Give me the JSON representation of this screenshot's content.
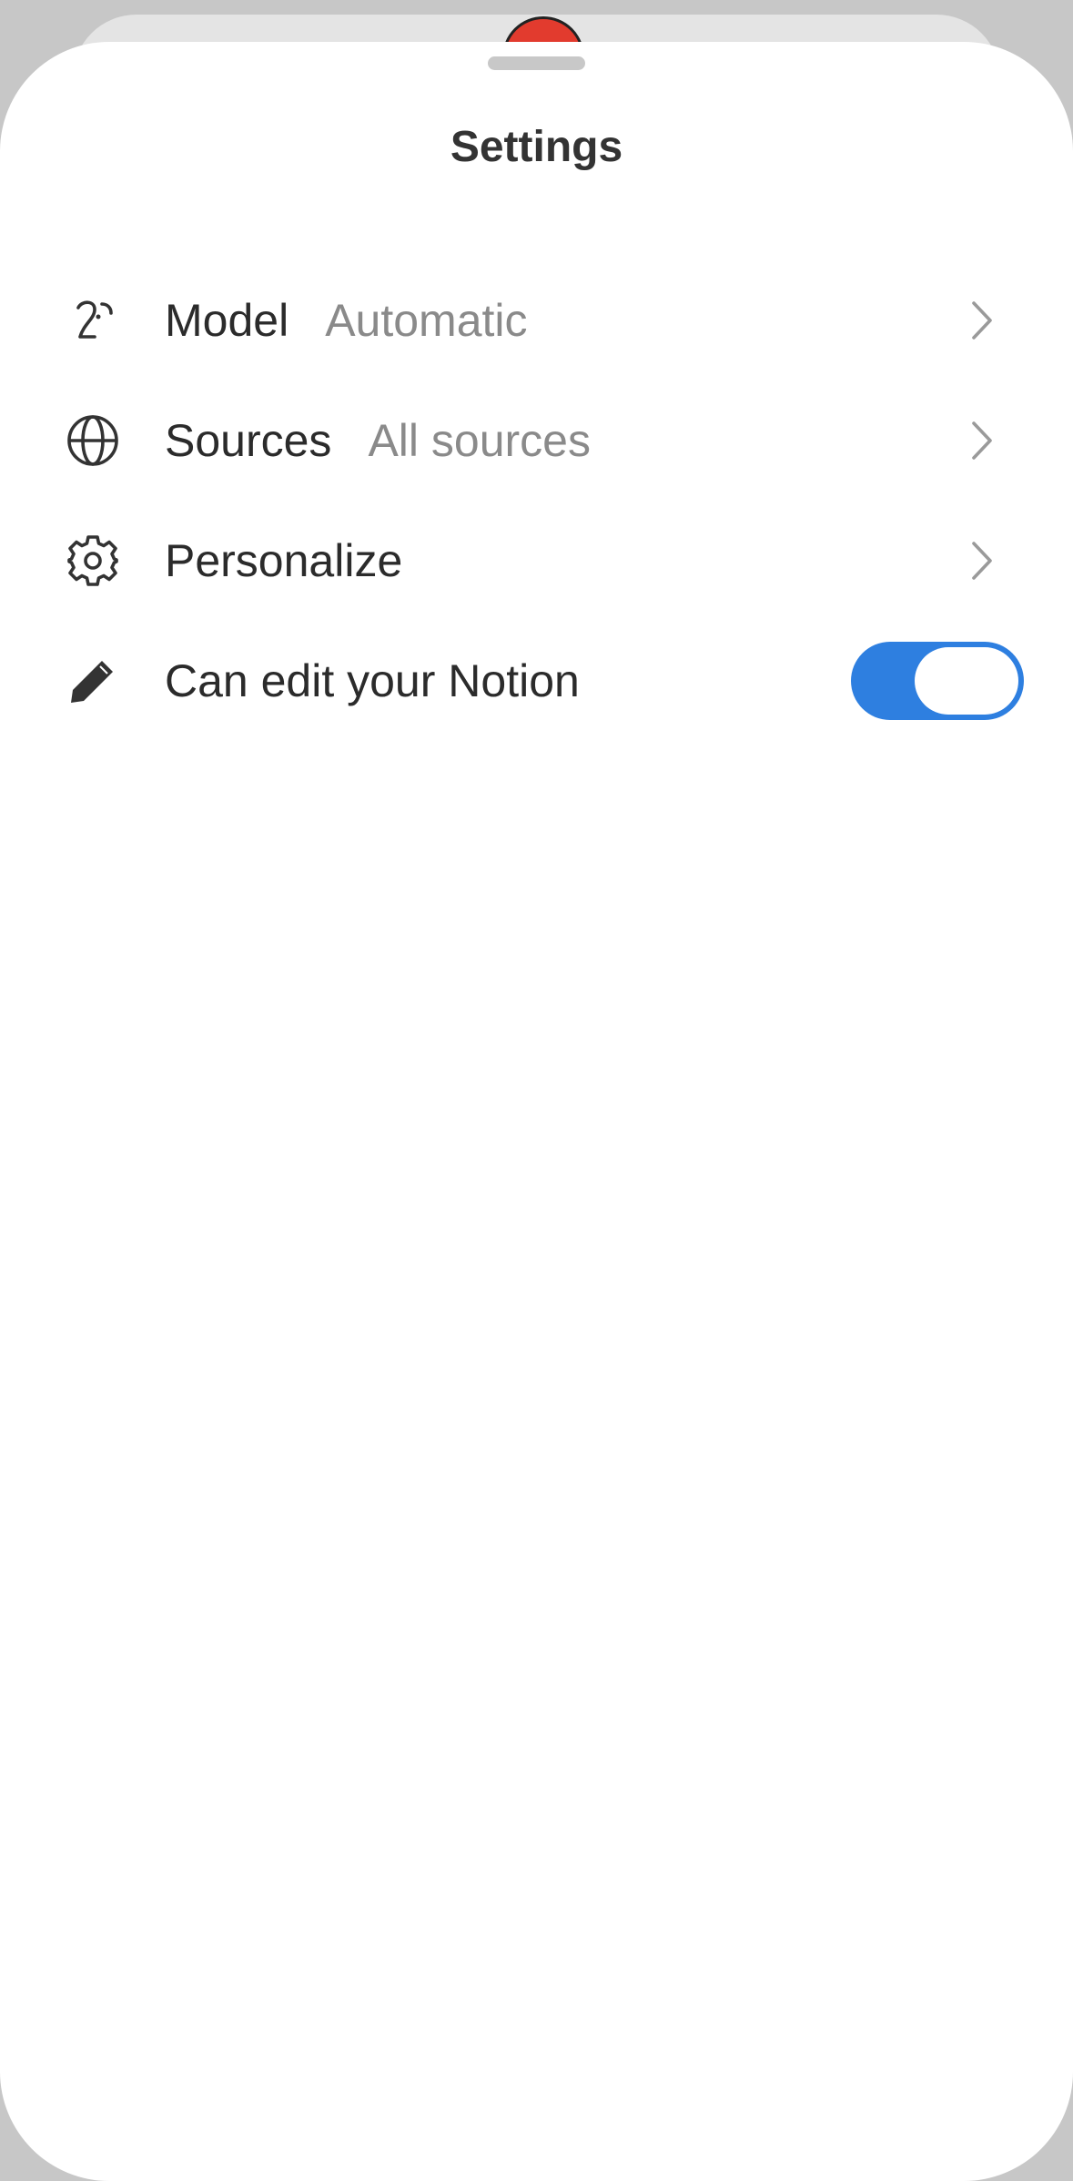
{
  "sheet": {
    "title": "Settings"
  },
  "rows": [
    {
      "label": "Model",
      "value": "Automatic",
      "icon": "model-icon",
      "control": "chevron"
    },
    {
      "label": "Sources",
      "value": "All sources",
      "icon": "globe-icon",
      "control": "chevron"
    },
    {
      "label": "Personalize",
      "value": "",
      "icon": "gear-icon",
      "control": "chevron"
    },
    {
      "label": "Can edit your Notion",
      "value": "",
      "icon": "pencil-icon",
      "control": "toggle",
      "toggle_on": true
    }
  ],
  "colors": {
    "accent": "#2e7fe0",
    "label": "#2b2b2b",
    "value": "#8a8a8a",
    "background": "#ffffff"
  }
}
